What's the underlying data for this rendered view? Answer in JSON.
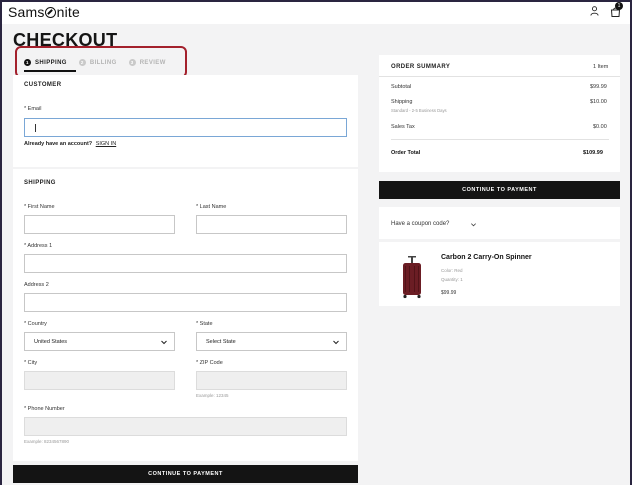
{
  "header": {
    "logo_pre": "Sams",
    "logo_post": "nite",
    "cart_count": "1"
  },
  "page": {
    "title": "CHECKOUT"
  },
  "steps": [
    {
      "num": "1",
      "label": "SHIPPING"
    },
    {
      "num": "2",
      "label": "BILLING"
    },
    {
      "num": "3",
      "label": "REVIEW"
    }
  ],
  "customer": {
    "title": "CUSTOMER",
    "email_label": "* Email",
    "account_prompt": "Already have an account?",
    "sign_in": "SIGN IN"
  },
  "shipping": {
    "title": "SHIPPING",
    "first_name_label": "* First Name",
    "last_name_label": "* Last Name",
    "address1_label": "* Address 1",
    "address2_label": "Address 2",
    "country_label": "* Country",
    "country_value": "United States",
    "state_label": "* State",
    "state_value": "Select State",
    "city_label": "* City",
    "zip_label": "* ZIP Code",
    "zip_hint": "Example: 12345",
    "phone_label": "* Phone Number",
    "phone_hint": "Example: 8234567890",
    "continue_label": "CONTINUE TO PAYMENT"
  },
  "summary": {
    "title": "ORDER SUMMARY",
    "item_count": "1 Item",
    "subtotal_label": "Subtotal",
    "subtotal_value": "$99.99",
    "shipping_label": "Shipping",
    "shipping_value": "$10.00",
    "shipping_method": "Standard - 2-5 Business Days",
    "tax_label": "Sales Tax",
    "tax_value": "$0.00",
    "total_label": "Order Total",
    "total_value": "$109.99",
    "continue_label": "CONTINUE TO PAYMENT",
    "coupon_label": "Have a coupon code?"
  },
  "product": {
    "name": "Carbon 2 Carry-On Spinner",
    "color": "Color: Red",
    "quantity": "Quantity: 1",
    "price": "$99.99"
  },
  "colors": {
    "highlight_box": "#a3202c",
    "button_bg": "#141414",
    "suitcase": "#6b1d24"
  },
  "icons": [
    "user-icon",
    "cart-icon",
    "chevron-down-icon",
    "suitcase-image"
  ]
}
